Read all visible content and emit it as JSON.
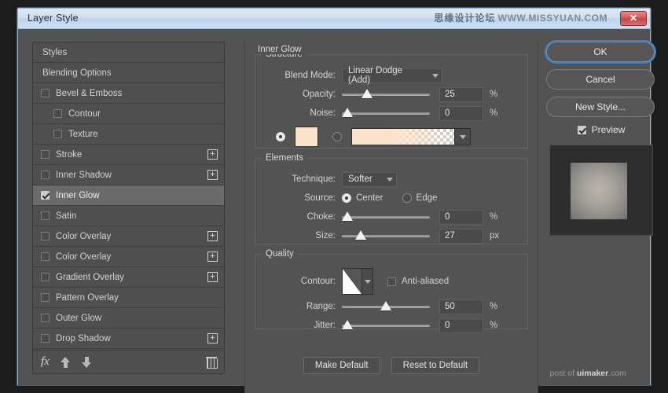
{
  "window": {
    "title": "Layer Style",
    "close_label": "✕",
    "watermark_top_cn": "思缘设计论坛",
    "watermark_top_en": "WWW.MISSYUAN.COM",
    "watermark_bottom_prefix": "post of ",
    "watermark_bottom_brand": "uimaker",
    "watermark_bottom_suffix": ".com"
  },
  "styles_list": [
    {
      "label": "Styles",
      "type": "header",
      "checked": false,
      "plus": false,
      "indent": false,
      "selected": false
    },
    {
      "label": "Blending Options",
      "type": "header",
      "checked": false,
      "plus": false,
      "indent": false,
      "selected": false
    },
    {
      "label": "Bevel & Emboss",
      "type": "check",
      "checked": false,
      "plus": false,
      "indent": false,
      "selected": false
    },
    {
      "label": "Contour",
      "type": "check",
      "checked": false,
      "plus": false,
      "indent": true,
      "selected": false
    },
    {
      "label": "Texture",
      "type": "check",
      "checked": false,
      "plus": false,
      "indent": true,
      "selected": false
    },
    {
      "label": "Stroke",
      "type": "check",
      "checked": false,
      "plus": true,
      "indent": false,
      "selected": false
    },
    {
      "label": "Inner Shadow",
      "type": "check",
      "checked": false,
      "plus": true,
      "indent": false,
      "selected": false
    },
    {
      "label": "Inner Glow",
      "type": "check",
      "checked": true,
      "plus": false,
      "indent": false,
      "selected": true
    },
    {
      "label": "Satin",
      "type": "check",
      "checked": false,
      "plus": false,
      "indent": false,
      "selected": false
    },
    {
      "label": "Color Overlay",
      "type": "check",
      "checked": false,
      "plus": true,
      "indent": false,
      "selected": false
    },
    {
      "label": "Color Overlay",
      "type": "check",
      "checked": false,
      "plus": true,
      "indent": false,
      "selected": false
    },
    {
      "label": "Gradient Overlay",
      "type": "check",
      "checked": false,
      "plus": true,
      "indent": false,
      "selected": false
    },
    {
      "label": "Pattern Overlay",
      "type": "check",
      "checked": false,
      "plus": false,
      "indent": false,
      "selected": false
    },
    {
      "label": "Outer Glow",
      "type": "check",
      "checked": false,
      "plus": false,
      "indent": false,
      "selected": false
    },
    {
      "label": "Drop Shadow",
      "type": "check",
      "checked": false,
      "plus": true,
      "indent": false,
      "selected": false
    }
  ],
  "styles_footer": {
    "fx_label": "fx",
    "move_up_label": "▲",
    "move_down_label": "▼",
    "delete_label": "🗑"
  },
  "options": {
    "effect_title": "Inner Glow",
    "structure": {
      "legend": "Structure",
      "blend_mode_label": "Blend Mode:",
      "blend_mode_value": "Linear Dodge (Add)",
      "opacity_label": "Opacity:",
      "opacity_value": "25",
      "opacity_unit": "%",
      "opacity_percent": 25,
      "noise_label": "Noise:",
      "noise_value": "0",
      "noise_unit": "%",
      "noise_percent": 0,
      "fill_type": "color",
      "color_hex": "#FBE4CA",
      "gradient_from": "#FAE4C9",
      "gradient_to": "transparent"
    },
    "elements": {
      "legend": "Elements",
      "technique_label": "Technique:",
      "technique_value": "Softer",
      "source_label": "Source:",
      "source_center_label": "Center",
      "source_edge_label": "Edge",
      "source_value": "Center",
      "choke_label": "Choke:",
      "choke_value": "0",
      "choke_unit": "%",
      "choke_percent": 0,
      "size_label": "Size:",
      "size_value": "27",
      "size_unit": "px",
      "size_percent": 17
    },
    "quality": {
      "legend": "Quality",
      "contour_label": "Contour:",
      "anti_aliased_label": "Anti-aliased",
      "anti_aliased_checked": false,
      "range_label": "Range:",
      "range_value": "50",
      "range_unit": "%",
      "range_percent": 50,
      "jitter_label": "Jitter:",
      "jitter_value": "0",
      "jitter_unit": "%",
      "jitter_percent": 0
    },
    "make_default_label": "Make Default",
    "reset_default_label": "Reset to Default"
  },
  "right_panel": {
    "ok_label": "OK",
    "cancel_label": "Cancel",
    "new_style_label": "New Style...",
    "preview_label": "Preview",
    "preview_checked": true
  }
}
